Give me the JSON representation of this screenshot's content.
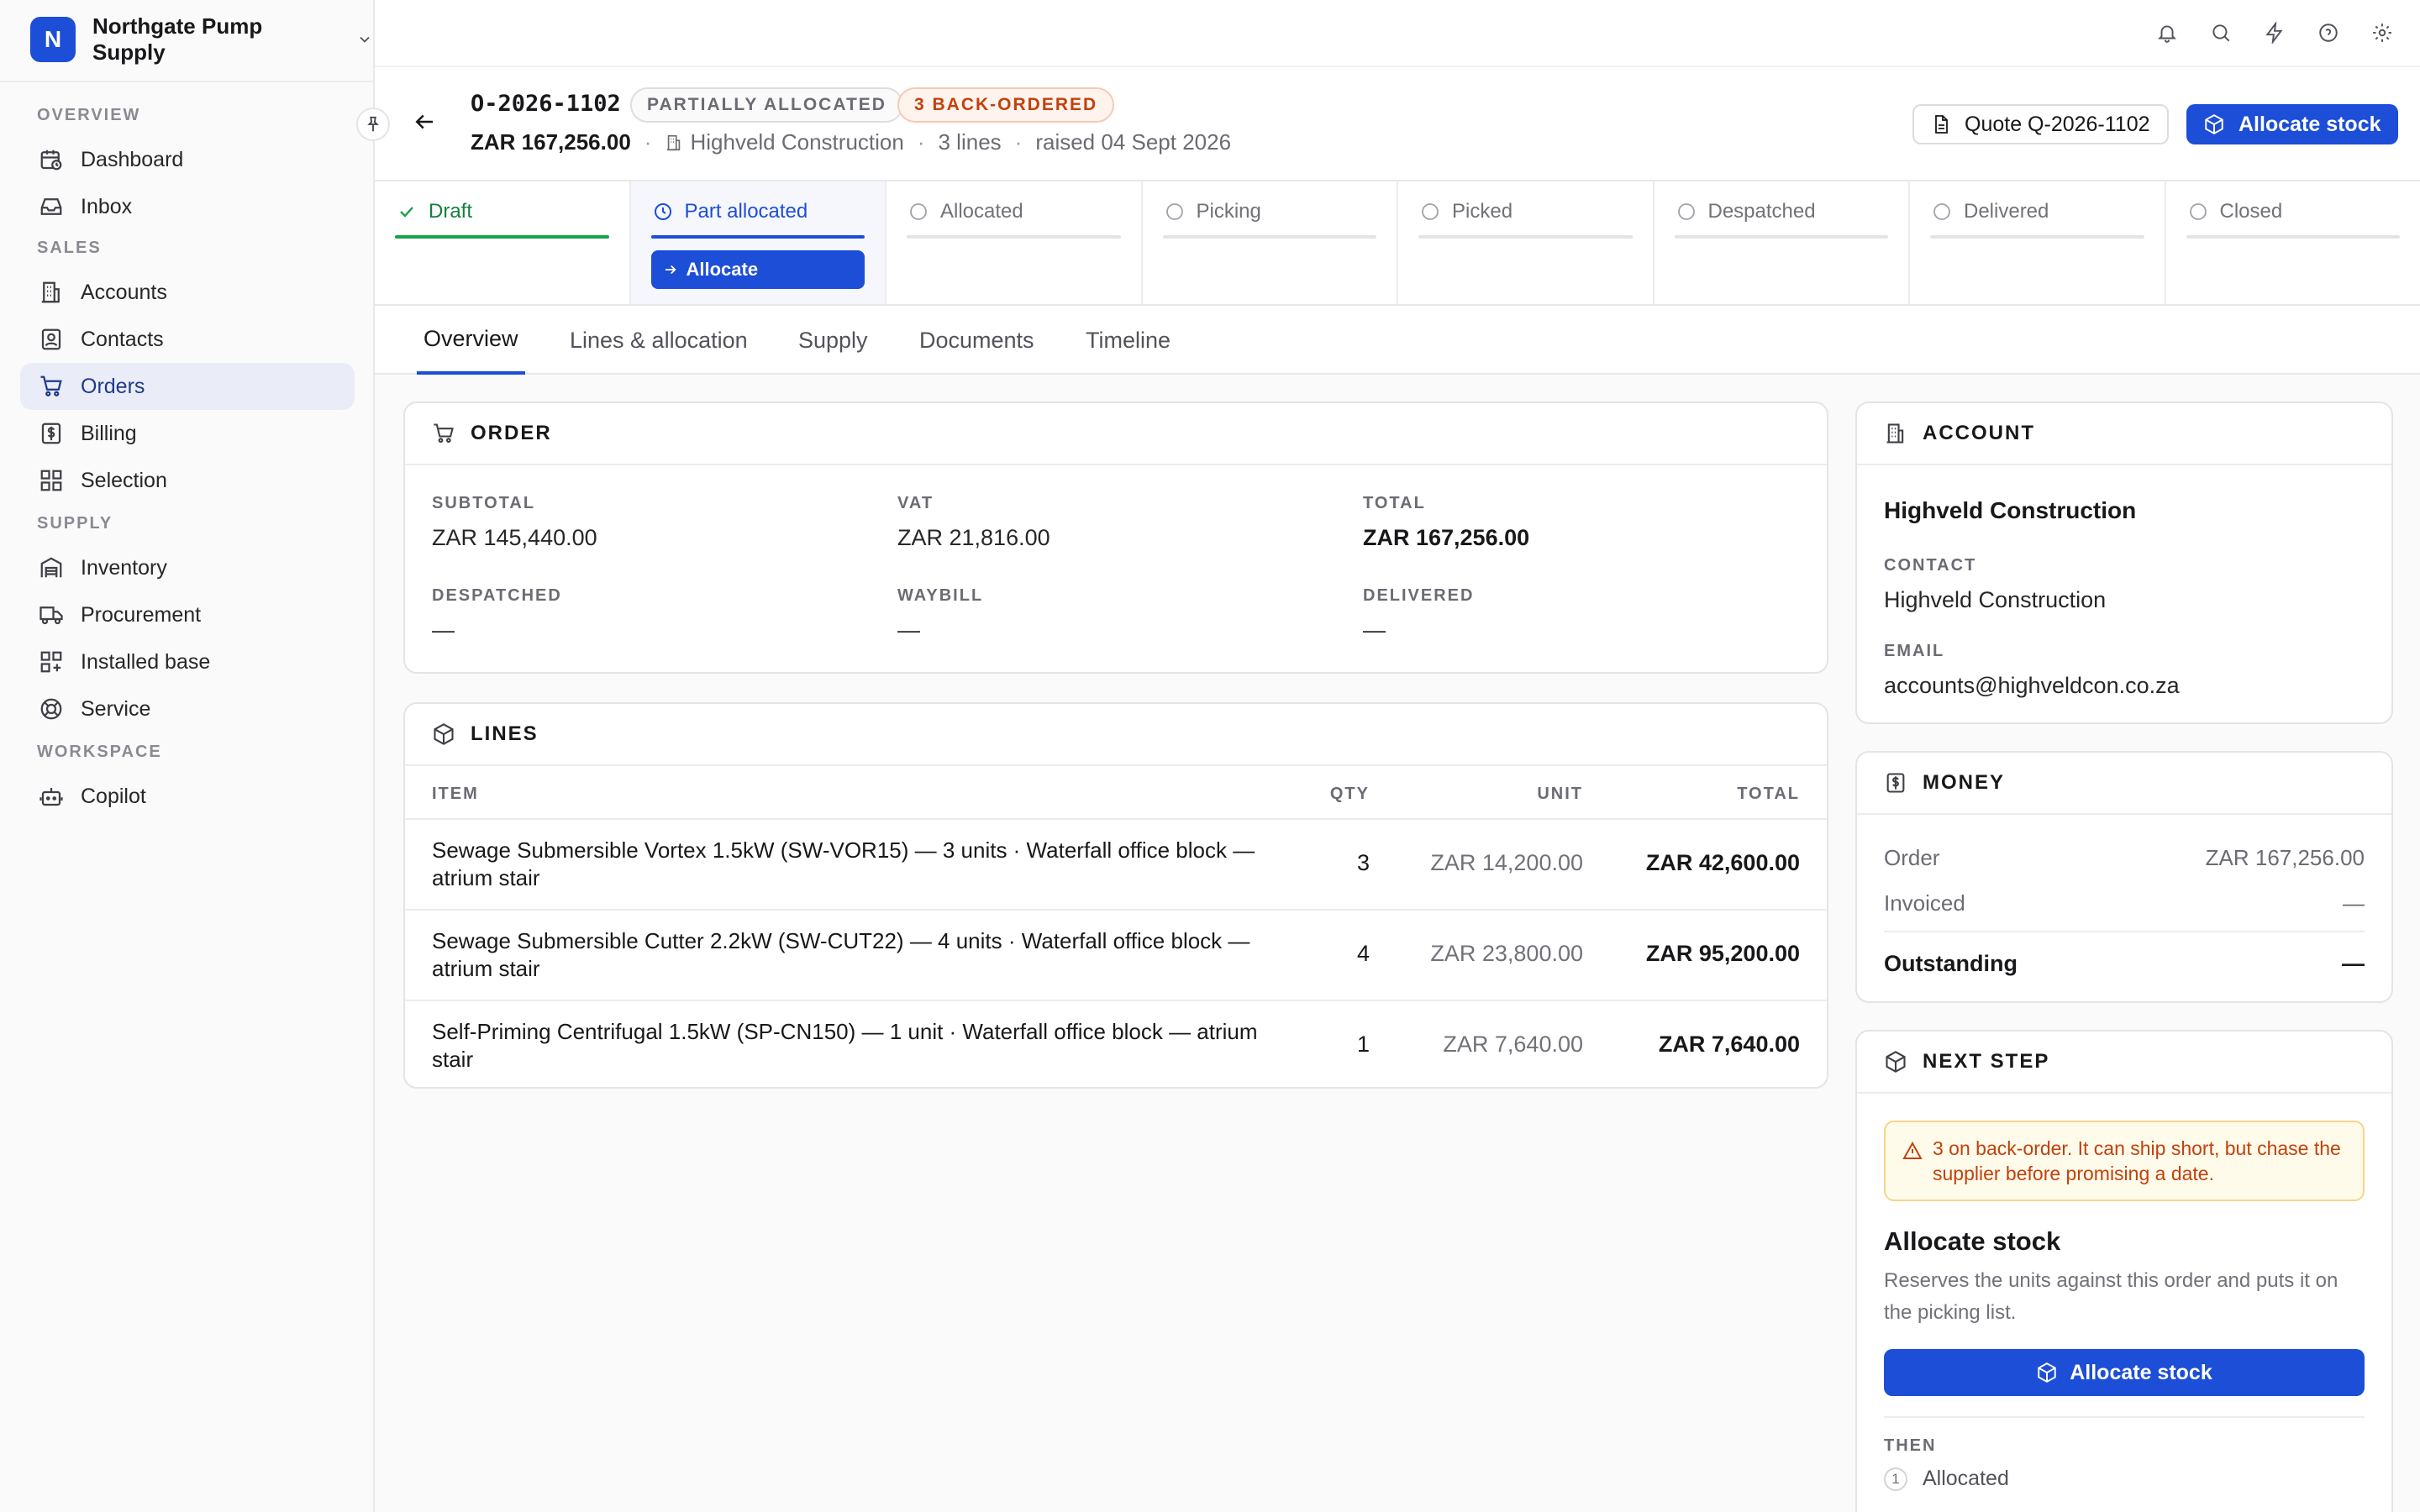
{
  "org": {
    "initial": "N",
    "name": "Northgate Pump Supply"
  },
  "nav": {
    "overview_label": "OVERVIEW",
    "sales_label": "SALES",
    "supply_label": "SUPPLY",
    "workspace_label": "WORKSPACE",
    "items": [
      {
        "label": "Dashboard",
        "icon": "calendar-clock-icon"
      },
      {
        "label": "Inbox",
        "icon": "inbox-icon"
      },
      {
        "label": "Accounts",
        "icon": "building-icon"
      },
      {
        "label": "Contacts",
        "icon": "contact-icon"
      },
      {
        "label": "Orders",
        "icon": "cart-icon",
        "active": true
      },
      {
        "label": "Billing",
        "icon": "dollar-receipt-icon"
      },
      {
        "label": "Selection",
        "icon": "grid-icon"
      },
      {
        "label": "Inventory",
        "icon": "warehouse-icon"
      },
      {
        "label": "Procurement",
        "icon": "truck-icon"
      },
      {
        "label": "Installed base",
        "icon": "grid-plus-icon"
      },
      {
        "label": "Service",
        "icon": "lifebuoy-icon"
      },
      {
        "label": "Copilot",
        "icon": "bot-icon"
      }
    ]
  },
  "topbar": {
    "icons": [
      "bell-icon",
      "search-icon",
      "bolt-icon",
      "help-icon",
      "gear-icon"
    ]
  },
  "header": {
    "order_id": "O-2026-1102",
    "badge_status": "PARTIALLY ALLOCATED",
    "badge_backorder": "3 BACK-ORDERED",
    "amount": "ZAR 167,256.00",
    "account": "Highveld Construction",
    "lines": "3 lines",
    "raised": "raised 04 Sept 2026",
    "dot": "·",
    "quote_button": "Quote Q-2026-1102",
    "allocate_button": "Allocate stock"
  },
  "stepper": {
    "steps": [
      "Draft",
      "Part allocated",
      "Allocated",
      "Picking",
      "Picked",
      "Despatched",
      "Delivered",
      "Closed"
    ],
    "done_index": 0,
    "current_index": 1,
    "action_label": "Allocate"
  },
  "tabs": [
    "Overview",
    "Lines & allocation",
    "Supply",
    "Documents",
    "Timeline"
  ],
  "order_card": {
    "title": "ORDER",
    "subtotal_label": "SUBTOTAL",
    "subtotal": "ZAR 145,440.00",
    "vat_label": "VAT",
    "vat": "ZAR 21,816.00",
    "total_label": "TOTAL",
    "total": "ZAR 167,256.00",
    "despatched_label": "DESPATCHED",
    "despatched": "—",
    "waybill_label": "WAYBILL",
    "waybill": "—",
    "delivered_label": "DELIVERED",
    "delivered": "—"
  },
  "lines_card": {
    "title": "LINES",
    "columns": {
      "item": "ITEM",
      "qty": "QTY",
      "unit": "UNIT",
      "total": "TOTAL"
    },
    "rows": [
      {
        "item": "Sewage Submersible Vortex 1.5kW (SW-VOR15) — 3 units · Waterfall office block — atrium stair",
        "qty": "3",
        "unit": "ZAR 14,200.00",
        "total": "ZAR 42,600.00"
      },
      {
        "item": "Sewage Submersible Cutter 2.2kW (SW-CUT22) — 4 units · Waterfall office block — atrium stair",
        "qty": "4",
        "unit": "ZAR 23,800.00",
        "total": "ZAR 95,200.00"
      },
      {
        "item": "Self-Priming Centrifugal 1.5kW (SP-CN150) — 1 unit · Waterfall office block — atrium stair",
        "qty": "1",
        "unit": "ZAR 7,640.00",
        "total": "ZAR 7,640.00"
      }
    ]
  },
  "account_card": {
    "title": "ACCOUNT",
    "name": "Highveld Construction",
    "contact_label": "CONTACT",
    "contact": "Highveld Construction",
    "email_label": "EMAIL",
    "email": "accounts@highveldcon.co.za"
  },
  "money_card": {
    "title": "MONEY",
    "order_label": "Order",
    "order": "ZAR 167,256.00",
    "invoiced_label": "Invoiced",
    "invoiced": "—",
    "outstanding_label": "Outstanding",
    "outstanding": "—"
  },
  "next_step": {
    "title": "NEXT STEP",
    "warning": "3 on back-order. It can ship short, but chase the supplier before promising a date.",
    "action_title": "Allocate stock",
    "description": "Reserves the units against this order and puts it on the picking list.",
    "button": "Allocate stock",
    "then_label": "THEN",
    "then_number": "1",
    "then_item": "Allocated"
  },
  "colors": {
    "accent": "#1d4ed8",
    "done": "#16a34a",
    "warning": "#c2410c"
  }
}
